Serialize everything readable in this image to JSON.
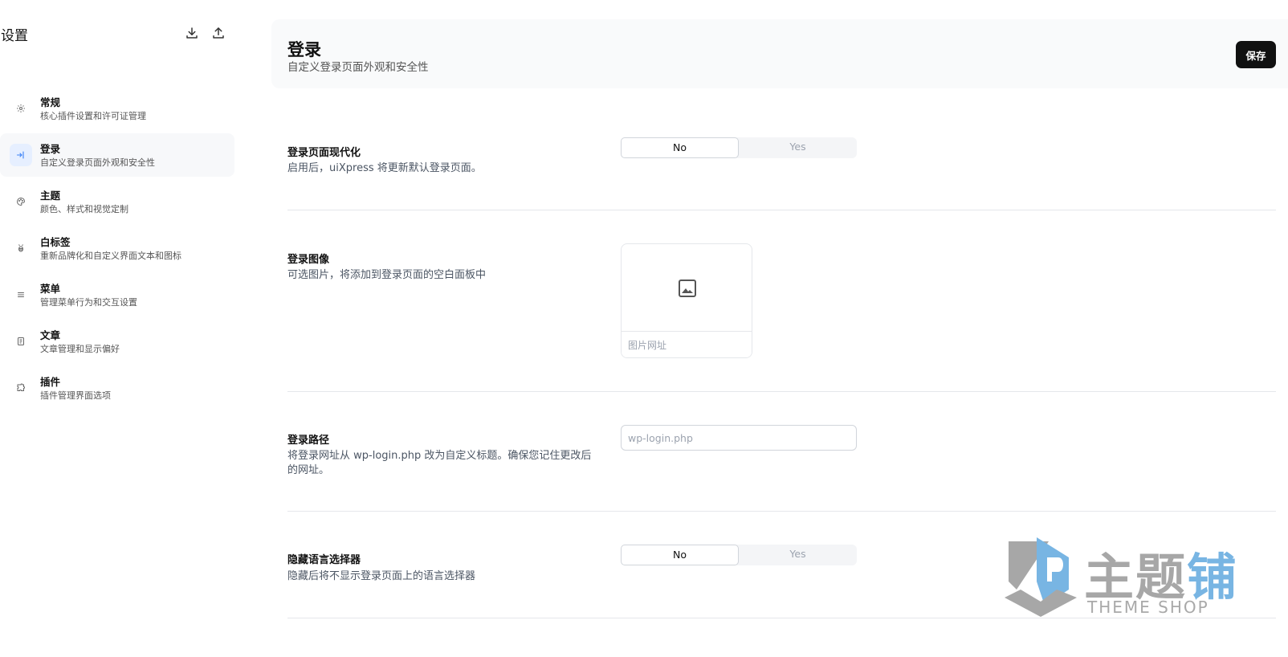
{
  "sidebar": {
    "title": "设置",
    "download_icon": "download-icon",
    "upload_icon": "upload-icon",
    "items": [
      {
        "label": "常规",
        "desc": "核心插件设置和许可证管理",
        "icon": "gear-icon"
      },
      {
        "label": "登录",
        "desc": "自定义登录页面外观和安全性",
        "icon": "login-icon"
      },
      {
        "label": "主题",
        "desc": "颜色、样式和视觉定制",
        "icon": "palette-icon"
      },
      {
        "label": "白标签",
        "desc": "重新品牌化和自定义界面文本和图标",
        "icon": "bee-icon"
      },
      {
        "label": "菜单",
        "desc": "管理菜单行为和交互设置",
        "icon": "menu-icon"
      },
      {
        "label": "文章",
        "desc": "文章管理和显示偏好",
        "icon": "document-icon"
      },
      {
        "label": "插件",
        "desc": "插件管理界面选项",
        "icon": "puzzle-icon"
      }
    ],
    "active_index": 1
  },
  "header": {
    "title": "登录",
    "subtitle": "自定义登录页面外观和安全性",
    "save_label": "保存"
  },
  "settings": {
    "modernize": {
      "label": "登录页面现代化",
      "desc": "启用后，uiXpress 将更新默认登录页面。",
      "option_no": "No",
      "option_yes": "Yes",
      "selected": "No"
    },
    "login_image": {
      "label": "登录图像",
      "desc": "可选图片，将添加到登录页面的空白面板中",
      "url_placeholder": "图片网址",
      "icon": "image-icon"
    },
    "login_path": {
      "label": "登录路径",
      "desc": "将登录网址从 wp-login.php 改为自定义标题。确保您记住更改后的网址。",
      "placeholder": "wp-login.php"
    },
    "hide_language": {
      "label": "隐藏语言选择器",
      "desc": "隐藏后将不显示登录页面上的语言选择器",
      "option_no": "No",
      "option_yes": "Yes",
      "selected": "No"
    }
  },
  "watermark": {
    "text_part1": "主题",
    "text_part2": "铺",
    "sub": "THEME SHOP"
  },
  "colors": {
    "accent": "#3b82f6",
    "save_bg": "#111111",
    "watermark_gray": "#9e9e9e",
    "watermark_blue": "#6aaee0"
  }
}
